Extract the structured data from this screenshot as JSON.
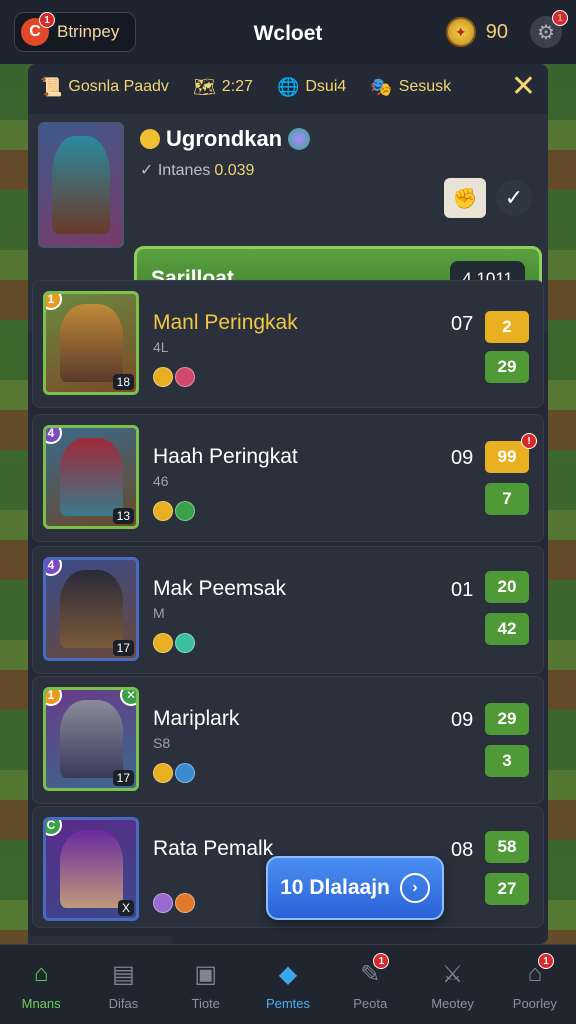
{
  "topbar": {
    "app_label": "Btrinpey",
    "app_badge": "1",
    "title": "Wcloet",
    "coins": "90",
    "settings_badge": "1"
  },
  "tabs": [
    {
      "label": "Gosnla Paadv",
      "icon": "scroll-icon"
    },
    {
      "label": "2:27",
      "icon": "map-icon"
    },
    {
      "label": "Dsui4",
      "icon": "globe-icon"
    },
    {
      "label": "Sesusk",
      "icon": "mask-icon"
    }
  ],
  "featured": {
    "name": "Ugrondkan",
    "sub_label": "Intanes",
    "sub_value": "0.039",
    "bar_label": "Sarilloat",
    "bar_count": "4 1011"
  },
  "rows": [
    {
      "name": "Manl Peringkak",
      "sub": "4L",
      "level": "18",
      "num": "07",
      "score1": "2",
      "score2": "29",
      "rank": "1",
      "gold": true,
      "score1_yellow": true,
      "badge": false
    },
    {
      "name": "Haah Peringkat",
      "sub": "46",
      "level": "13",
      "num": "09",
      "score1": "99",
      "score2": "7",
      "rank": "4",
      "gold": false,
      "score1_yellow": true,
      "badge": true
    },
    {
      "name": "Mak Peemsak",
      "sub": "M",
      "level": "17",
      "num": "01",
      "score1": "20",
      "score2": "42",
      "rank": "4",
      "gold": false,
      "score1_yellow": false,
      "badge": false
    },
    {
      "name": "Mariplark",
      "sub": "S8",
      "level": "17",
      "num": "09",
      "score1": "29",
      "score2": "3",
      "rank": "1",
      "gold": false,
      "score1_yellow": false,
      "badge": false
    },
    {
      "name": "Rata Pemalk",
      "sub": "",
      "level": "X",
      "num": "08",
      "score1": "58",
      "score2": "27",
      "rank": "C",
      "gold": false,
      "score1_yellow": false,
      "badge": false
    }
  ],
  "play_button": "10 Dlalaajn",
  "nav": [
    {
      "label": "Mnans",
      "icon": "home-icon"
    },
    {
      "label": "Difas",
      "icon": "clipboard-icon"
    },
    {
      "label": "Tiote",
      "icon": "box-icon"
    },
    {
      "label": "Pemtes",
      "icon": "cube-icon"
    },
    {
      "label": "Peota",
      "icon": "skill-icon"
    },
    {
      "label": "Meotey",
      "icon": "sword-icon"
    },
    {
      "label": "Poorley",
      "icon": "chest-icon"
    }
  ],
  "nav_badges": {
    "peota": "1",
    "poorley": "1"
  },
  "colors": {
    "accent_green": "#4f9a36",
    "accent_yellow": "#e8b020",
    "primary_blue": "#2a62d8",
    "panel": "#232935"
  }
}
